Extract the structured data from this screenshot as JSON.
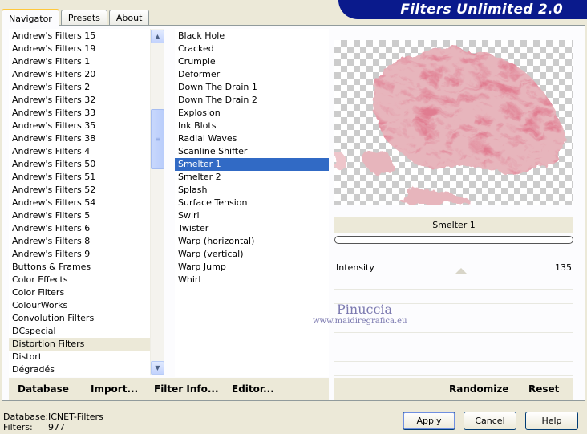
{
  "header": {
    "title": "Filters Unlimited 2.0"
  },
  "tabs": [
    {
      "label": "Navigator",
      "active": true
    },
    {
      "label": "Presets",
      "active": false
    },
    {
      "label": "About",
      "active": false
    }
  ],
  "categories": {
    "items": [
      "Andrew's Filters 15",
      "Andrew's Filters 19",
      "Andrew's Filters 1",
      "Andrew's Filters 20",
      "Andrew's Filters 2",
      "Andrew's Filters 32",
      "Andrew's Filters 33",
      "Andrew's Filters 35",
      "Andrew's Filters 38",
      "Andrew's Filters 4",
      "Andrew's Filters 50",
      "Andrew's Filters 51",
      "Andrew's Filters 52",
      "Andrew's Filters 54",
      "Andrew's Filters 5",
      "Andrew's Filters 6",
      "Andrew's Filters 8",
      "Andrew's Filters 9",
      "Buttons & Frames",
      "Color Effects",
      "Color Filters",
      "ColourWorks",
      "Convolution Filters",
      "DCspecial",
      "Distortion Filters",
      "Distort",
      "Dégradés"
    ],
    "selected": "Distortion Filters"
  },
  "filters": {
    "items": [
      "Black Hole",
      "Cracked",
      "Crumple",
      "Deformer",
      "Down The Drain 1",
      "Down The Drain 2",
      "Explosion",
      "Ink Blots",
      "Radial Waves",
      "Scanline Shifter",
      "Smelter 1",
      "Smelter 2",
      "Splash",
      "Surface Tension",
      "Swirl",
      "Twister",
      "Warp (horizontal)",
      "Warp (vertical)",
      "Warp Jump",
      "Whirl"
    ],
    "selected": "Smelter 1"
  },
  "toolbar": {
    "database": "Database",
    "import": "Import...",
    "filter_info": "Filter Info...",
    "editor": "Editor...",
    "randomize": "Randomize",
    "reset": "Reset"
  },
  "preview": {
    "filter_name": "Smelter 1"
  },
  "params": [
    {
      "label": "Intensity",
      "value": "135"
    }
  ],
  "watermark": {
    "name": "Pinuccia",
    "url": "www.maidiregrafica.eu"
  },
  "status": {
    "database_label": "Database:",
    "database_value": "ICNET-Filters",
    "filters_label": "Filters:",
    "filters_value": "977"
  },
  "buttons": {
    "apply": "Apply",
    "cancel": "Cancel",
    "help": "Help"
  },
  "colors": {
    "selection": "#316ac5",
    "banner": "#0a1a8c",
    "preview_tint": "#c0404f"
  }
}
